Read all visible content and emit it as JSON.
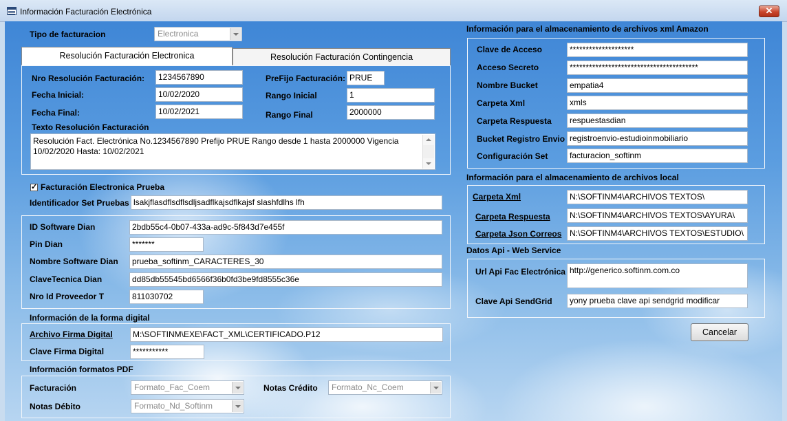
{
  "window": {
    "title": "Información Facturación Electrónica",
    "close_label": "✕"
  },
  "left": {
    "tipo_label": "Tipo de facturacion",
    "tipo_value": "Electronica",
    "tabs": [
      {
        "label": "Resolución Facturación Electronica"
      },
      {
        "label": "Resolución Facturación Contingencia"
      }
    ],
    "resolucion": {
      "nro_label": "Nro Resolución Facturación:",
      "nro_value": "1234567890",
      "fecha_ini_label": "Fecha Inicial:",
      "fecha_ini_value": "10/02/2020",
      "fecha_fin_label": "Fecha Final:",
      "fecha_fin_value": "10/02/2021",
      "prefijo_label": "PreFijo Facturación:",
      "prefijo_value": "PRUE",
      "rango_ini_label": "Rango Inicial",
      "rango_ini_value": "1",
      "rango_fin_label": "Rango Final",
      "rango_fin_value": "2000000",
      "texto_label": "Texto Resolución Facturación",
      "texto_value": "Resolución Fact. Electrónica No.1234567890 Prefijo PRUE Rango desde 1 hasta 2000000 Vigencia 10/02/2020 Hasta: 10/02/2021"
    },
    "prueba_check": {
      "checked": "✓",
      "label": "Facturación Electronica Prueba"
    },
    "set_pruebas_label": "Identificador Set Pruebas",
    "set_pruebas_value": "lsakjflasdflsdflsdljsadflkajsdflkajsf slashfdlhs lfh",
    "dian": {
      "id_label": "ID Software Dian",
      "id_value": "2bdb55c4-0b07-433a-ad9c-5f843d7e455f",
      "pin_label": "Pin Dian",
      "pin_value": "*******",
      "nombre_label": "Nombre Software Dian",
      "nombre_value": "prueba_softinm_CARACTERES_30",
      "clave_label": "ClaveTecnica Dian",
      "clave_value": "dd85db55545bd6566f36b0fd3be9fd8555c36e",
      "proveedor_label": "Nro Id Proveedor T",
      "proveedor_value": "811030702"
    },
    "firma": {
      "section_label": "Información de la forma digital",
      "archivo_label": "Archivo Firma Digital",
      "archivo_value": "M:\\SOFTINM\\EXE\\FACT_XML\\CERTIFICADO.P12",
      "clave_label": "Clave Firma Digital",
      "clave_value": "***********"
    },
    "pdf": {
      "section_label": "Información formatos PDF",
      "facturacion_label": "Facturación",
      "facturacion_value": "Formato_Fac_Coem",
      "notas_credito_label": "Notas Crédito",
      "notas_credito_value": "Formato_Nc_Coem",
      "notas_debito_label": "Notas Débito",
      "notas_debito_value": "Formato_Nd_Softinm"
    }
  },
  "right": {
    "amazon": {
      "section_label": "Información para el almacenamiento de archivos xml Amazon",
      "rows": [
        {
          "label": "Clave de Acceso",
          "value": "********************"
        },
        {
          "label": "Acceso Secreto",
          "value": "****************************************"
        },
        {
          "label": "Nombre Bucket",
          "value": "empatia4"
        },
        {
          "label": "Carpeta Xml",
          "value": "xmls"
        },
        {
          "label": "Carpeta Respuesta",
          "value": "respuestasdian"
        },
        {
          "label": "Bucket Registro Envio",
          "value": "registroenvio-estudioinmobiliario"
        },
        {
          "label": "Configuración Set",
          "value": "facturacion_softinm"
        }
      ]
    },
    "local": {
      "section_label": "Información para el almacenamiento de archivos local",
      "rows": [
        {
          "label": "Carpeta Xml",
          "value": "N:\\SOFTINM4\\ARCHIVOS TEXTOS\\"
        },
        {
          "label": "Carpeta Respuesta",
          "value": "N:\\SOFTINM4\\ARCHIVOS TEXTOS\\AYURA\\"
        },
        {
          "label": "Carpeta Json Correos",
          "value": "N:\\SOFTINM4\\ARCHIVOS TEXTOS\\ESTUDIO\\"
        }
      ]
    },
    "api": {
      "section_label": "Datos Api - Web Service",
      "url_label": "Url Api Fac Electrónica",
      "url_value": "http://generico.softinm.com.co",
      "sendgrid_label": "Clave Api SendGrid",
      "sendgrid_value": "yony prueba clave api sendgrid modificar"
    },
    "cancel_label": "Cancelar"
  }
}
